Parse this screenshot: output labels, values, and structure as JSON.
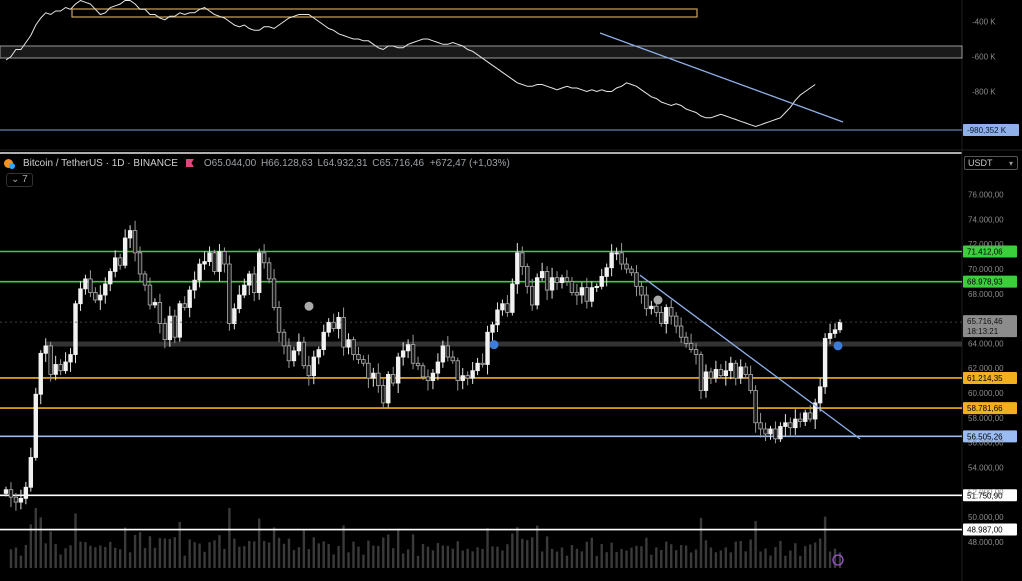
{
  "header": {
    "symbol": "Bitcoin / TetherUS · 1D · BINANCE",
    "ohlc": [
      {
        "k": "O",
        "v": "65.044,00"
      },
      {
        "k": "H",
        "v": "66.128,63"
      },
      {
        "k": "L",
        "v": "64.932,31"
      },
      {
        "k": "C",
        "v": "65.716,46"
      }
    ],
    "change": "+672,47 (+1,03%)",
    "collapse_label": "7",
    "currency": "USDT"
  },
  "indicator_axis": {
    "ticks": [
      "-400 K",
      "-600 K",
      "-800 K"
    ],
    "value_label": "-980,352 K"
  },
  "price_axis": {
    "ticks": [
      "76.000,00",
      "74.000,00",
      "72.000,00",
      "70.000,00",
      "68.000,00",
      "66.000,00",
      "64.000,00",
      "62.000,00",
      "60.000,00",
      "58.000,00",
      "56.000,00",
      "54.000,00",
      "52.000,00",
      "50.000,00",
      "48.000,00"
    ],
    "current_price": "65.716,46",
    "countdown": "18:13:21"
  },
  "levels": [
    {
      "label": "71.412,06",
      "color": "#3ccf3c"
    },
    {
      "label": "68.978,93",
      "color": "#3ccf3c"
    },
    {
      "label": "61.214,35",
      "color": "#f2b01f"
    },
    {
      "label": "58.781,66",
      "color": "#f2b01f"
    },
    {
      "label": "56.505,26",
      "color": "#9bbcf2"
    },
    {
      "label": "51.750,90",
      "color": "#ffffff"
    },
    {
      "label": "48.987,00",
      "color": "#ffffff"
    }
  ],
  "chart_data": {
    "type": "candlestick",
    "symbol": "BTC/USDT",
    "timeframe": "1D",
    "ylim": [
      47500,
      77500
    ],
    "indicator_ylim": [
      -1020,
      -300
    ],
    "closes": [
      52200,
      51600,
      51200,
      51500,
      52400,
      54800,
      59900,
      63200,
      63800,
      61500,
      62300,
      61800,
      62500,
      63100,
      67200,
      68400,
      69200,
      68100,
      67500,
      67900,
      68800,
      69800,
      70900,
      70300,
      72500,
      73100,
      71300,
      69600,
      68700,
      67100,
      67300,
      65600,
      64300,
      66200,
      64500,
      67200,
      66900,
      68300,
      69100,
      70400,
      70600,
      71300,
      69800,
      71400,
      70400,
      65600,
      66800,
      67900,
      68700,
      69600,
      68100,
      71300,
      70500,
      69200,
      66900,
      64900,
      63800,
      62600,
      63400,
      64100,
      62200,
      61400,
      62900,
      63500,
      64900,
      65700,
      65200,
      66100,
      63700,
      64300,
      63100,
      62700,
      62400,
      61200,
      61600,
      60600,
      59200,
      61500,
      60800,
      62900,
      63400,
      63900,
      62400,
      62200,
      61300,
      61000,
      61600,
      62500,
      63800,
      62900,
      62600,
      61000,
      61400,
      61200,
      61800,
      62400,
      62300,
      64900,
      65500,
      66700,
      67200,
      66500,
      68800,
      71300,
      70200,
      68600,
      67100,
      69300,
      69800,
      68300,
      69300,
      68900,
      69300,
      69000,
      68100,
      67900,
      68500,
      67400,
      68500,
      68600,
      69400,
      70100,
      71300,
      71300,
      70400,
      70000,
      69700,
      68600,
      67900,
      66800,
      67000,
      66500,
      65600,
      66900,
      66200,
      65400,
      64500,
      64000,
      63500,
      63100,
      60200,
      61700,
      61200,
      61900,
      61400,
      61800,
      62400,
      61200,
      62100,
      61500,
      60200,
      57600,
      57100,
      56700,
      57100,
      56300,
      57300,
      57600,
      57200,
      57900,
      57700,
      58400,
      57900,
      59200,
      60500,
      64400,
      64800,
      65100,
      65700
    ],
    "indicator": [
      -620,
      -600,
      -560,
      -560,
      -520,
      -480,
      -420,
      -380,
      -350,
      -360,
      -340,
      -340,
      -320,
      -330,
      -300,
      -280,
      -290,
      -300,
      -330,
      -360,
      -350,
      -320,
      -310,
      -300,
      -280,
      -280,
      -300,
      -330,
      -330,
      -360,
      -360,
      -380,
      -390,
      -370,
      -370,
      -350,
      -360,
      -350,
      -350,
      -330,
      -320,
      -340,
      -360,
      -370,
      -380,
      -400,
      -420,
      -430,
      -420,
      -440,
      -450,
      -450,
      -430,
      -430,
      -440,
      -420,
      -400,
      -380,
      -370,
      -360,
      -360,
      -360,
      -380,
      -400,
      -420,
      -440,
      -450,
      -470,
      -480,
      -490,
      -500,
      -500,
      -510,
      -510,
      -530,
      -550,
      -560,
      -540,
      -540,
      -550,
      -550,
      -530,
      -520,
      -510,
      -500,
      -500,
      -510,
      -520,
      -530,
      -530,
      -520,
      -530,
      -540,
      -560,
      -570,
      -590,
      -610,
      -630,
      -650,
      -670,
      -690,
      -710,
      -730,
      -750,
      -760,
      -770,
      -770,
      -760,
      -760,
      -770,
      -780,
      -790,
      -780,
      -770,
      -780,
      -780,
      -790,
      -800,
      -790,
      -800,
      -790,
      -800,
      -800,
      -780,
      -770,
      -750,
      -760,
      -770,
      -790,
      -810,
      -830,
      -840,
      -860,
      -870,
      -880,
      -870,
      -880,
      -900,
      -910,
      -920,
      -940,
      -950,
      -950,
      -940,
      -930,
      -940,
      -950,
      -960,
      -970,
      -980,
      -990,
      -1000,
      -990,
      -980,
      -970,
      -960,
      -950,
      -920,
      -890,
      -850,
      -820,
      -800,
      -780,
      -760
    ]
  }
}
